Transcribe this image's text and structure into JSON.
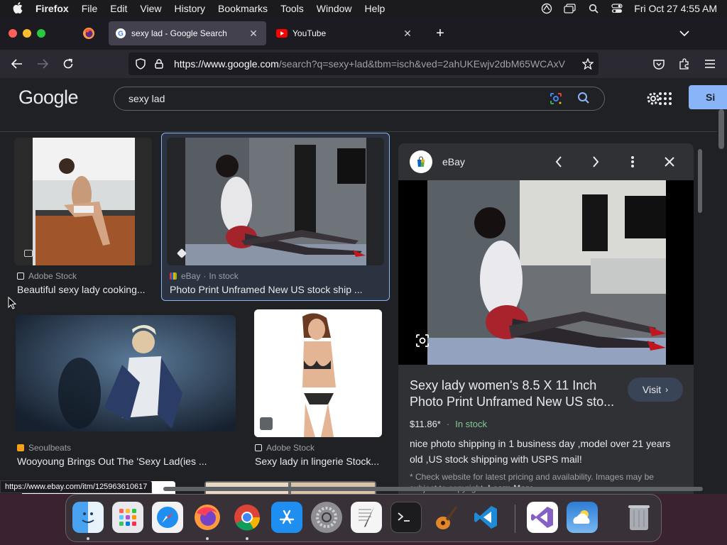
{
  "menubar": {
    "app_name": "Firefox",
    "menus": [
      "File",
      "Edit",
      "View",
      "History",
      "Bookmarks",
      "Tools",
      "Window",
      "Help"
    ],
    "clock": "Fri Oct 27  4:55 AM",
    "status_icons": [
      "vpn-icon",
      "screen-mirroring-icon",
      "spotlight-search-icon",
      "control-center-icon"
    ]
  },
  "browser": {
    "tabs": [
      {
        "title": "sexy lad - Google Search",
        "favicon": "google-icon",
        "active": true
      },
      {
        "title": "YouTube",
        "favicon": "youtube-icon",
        "active": false
      }
    ],
    "url_host": "https://www.google.com",
    "url_rest": "/search?q=sexy+lad&tbm=isch&ved=2ahUKEwjv2dbM65WCAxV",
    "status_url": "https://www.ebay.com/itm/125963610617"
  },
  "google": {
    "logo": "Google",
    "query": "sexy lad",
    "signin_label": "Si"
  },
  "results": [
    {
      "source": "Adobe Stock",
      "title": "Beautiful sexy lady cooking..."
    },
    {
      "source": "eBay",
      "stock": "In stock",
      "title": "Photo Print Unframed New US stock ship ..."
    },
    {
      "source": "Seoulbeats",
      "title": "Wooyoung Brings Out The 'Sexy Lad(ies ..."
    },
    {
      "source": "Adobe Stock",
      "title": "Sexy lady in lingerie Stock..."
    }
  ],
  "preview": {
    "source": "eBay",
    "title": "Sexy lady women's 8.5 X 11 Inch Photo Print Unframed New US sto...",
    "visit_label": "Visit",
    "price": "$11.86*",
    "separator": "·",
    "stock": "In stock",
    "description": "nice photo shipping in 1 business day ,model over 21 years old ,US stock shipping with USPS mail!",
    "disclaimer": "* Check website for latest pricing and availability. Images may be subject to copyright.",
    "learn_more": "Learn More"
  },
  "dock": {
    "apps": [
      "Finder",
      "Launchpad",
      "Safari",
      "Firefox",
      "Chrome",
      "App Store",
      "System Settings",
      "TextEdit",
      "Terminal",
      "GarageBand",
      "Visual Studio Code",
      "Visual Studio",
      "Weather",
      "Trash"
    ]
  },
  "colors": {
    "accent": "#8ab4f8",
    "in_stock": "#81c995",
    "page_bg": "#202124"
  }
}
